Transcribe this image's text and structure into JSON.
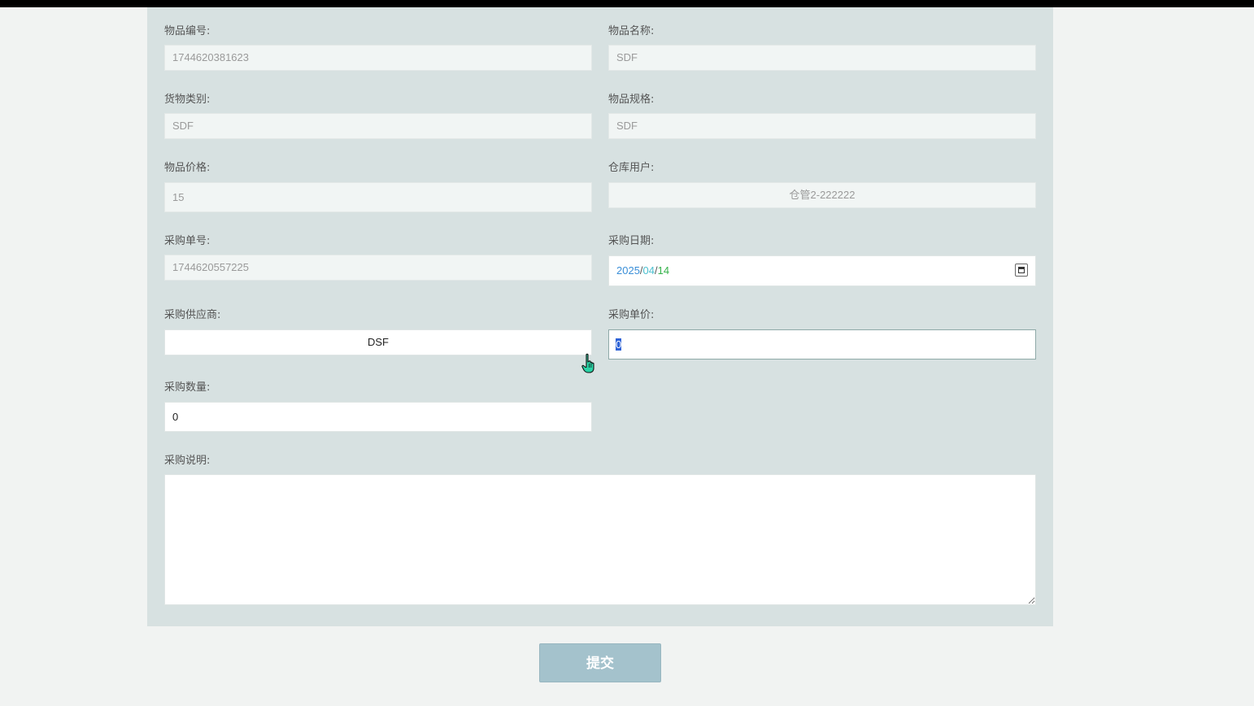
{
  "form": {
    "item_code": {
      "label": "物品编号:",
      "value": "1744620381623"
    },
    "item_name": {
      "label": "物品名称:",
      "value": "SDF"
    },
    "category": {
      "label": "货物类别:",
      "value": "SDF"
    },
    "spec": {
      "label": "物品规格:",
      "value": "SDF"
    },
    "price": {
      "label": "物品价格:",
      "value": "15"
    },
    "warehouse_user": {
      "label": "仓库用户:",
      "value": "仓管2-222222"
    },
    "order_no": {
      "label": "采购单号:",
      "value": "1744620557225"
    },
    "purchase_date": {
      "label": "采购日期:",
      "year": "2025",
      "month": "04",
      "day": "14",
      "sep": "/"
    },
    "supplier": {
      "label": "采购供应商:",
      "value": "DSF"
    },
    "unit_price": {
      "label": "采购单价:",
      "value": "0"
    },
    "quantity": {
      "label": "采购数量:",
      "value": "0"
    },
    "description": {
      "label": "采购说明:",
      "value": ""
    }
  },
  "submit_label": "提交",
  "icons": {
    "calendar": "calendar-icon",
    "cursor": "hand-pointer-icon"
  }
}
